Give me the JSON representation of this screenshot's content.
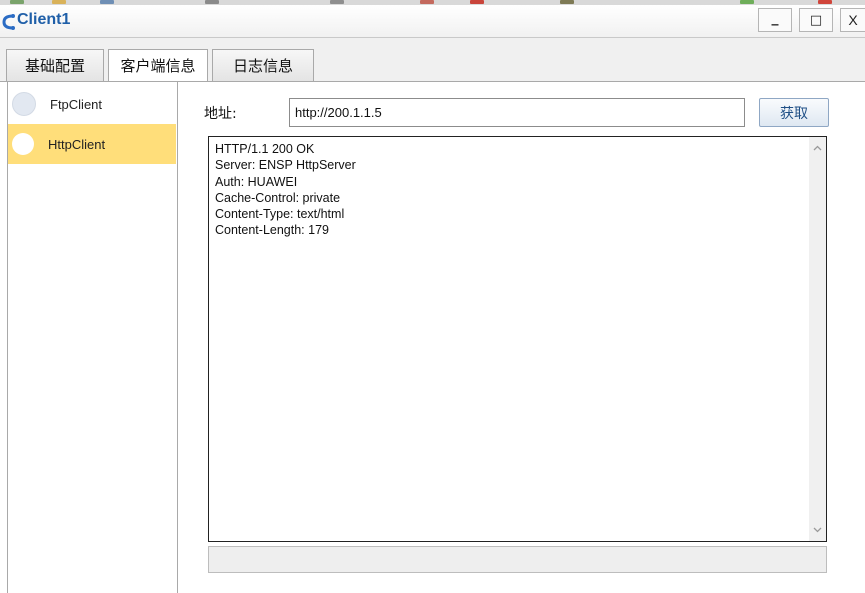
{
  "window": {
    "title": "Client1",
    "minimize_symbol": "_",
    "maximize_symbol": "□",
    "close_symbol": "X"
  },
  "tabs": [
    {
      "label": "基础配置",
      "active": false
    },
    {
      "label": "客户端信息",
      "active": true
    },
    {
      "label": "日志信息",
      "active": false
    }
  ],
  "sidebar": {
    "items": [
      {
        "label": "FtpClient",
        "selected": false
      },
      {
        "label": "HttpClient",
        "selected": true
      }
    ]
  },
  "address": {
    "label": "地址:",
    "value": "http://200.1.1.5"
  },
  "fetch_button": {
    "label": "获取"
  },
  "response": {
    "text": "HTTP/1.1 200 OK\nServer: ENSP HttpServer\nAuth: HUAWEI\nCache-Control: private\nContent-Type: text/html\nContent-Length: 179"
  },
  "colors": {
    "title": "#1f5fa8",
    "selected_item": "#ffde7a",
    "button_text": "#1f4f86"
  },
  "icons": {
    "app": "app-network-icon",
    "scroll_up": "chevron-up-icon",
    "scroll_down": "chevron-down-icon"
  }
}
